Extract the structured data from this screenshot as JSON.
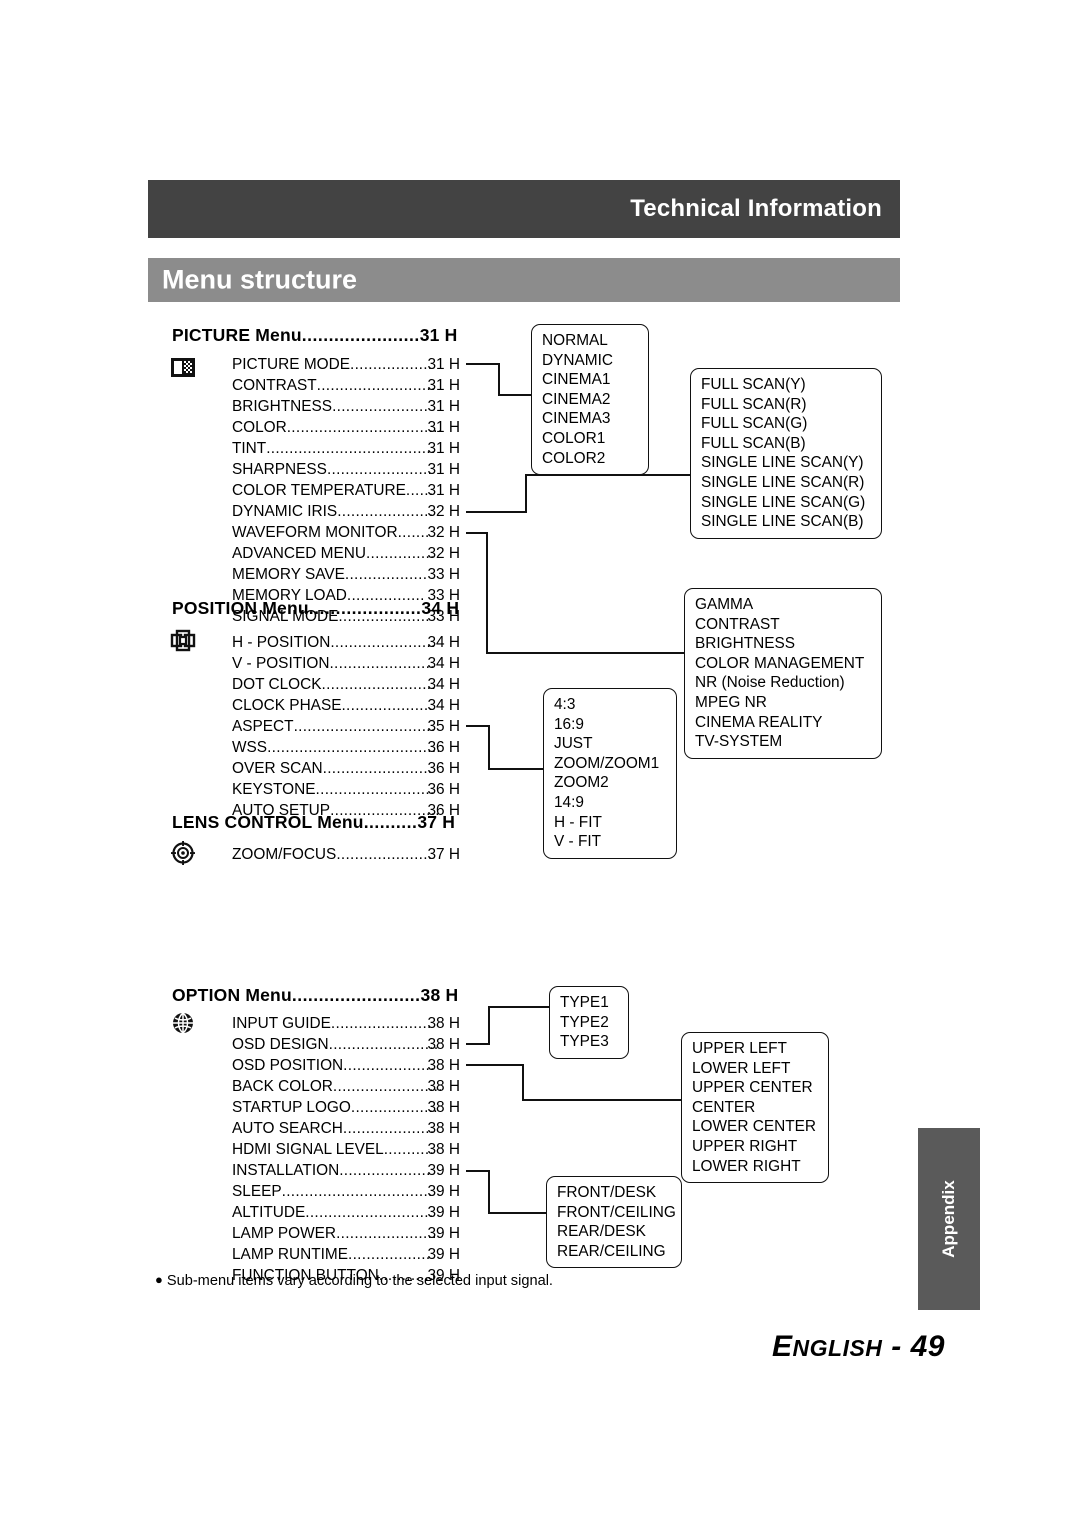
{
  "header": {
    "section_title": "Technical Information",
    "page_title": "Menu structure"
  },
  "menus": [
    {
      "id": "picture",
      "title": "PICTURE Menu",
      "dots": "......................",
      "page": "31 H",
      "icon": "picture-mode-icon",
      "items": [
        {
          "label": "PICTURE MODE",
          "dots": "..................",
          "page": "31 H"
        },
        {
          "label": "CONTRAST",
          "dots": "..........................",
          "page": "31 H"
        },
        {
          "label": "BRIGHTNESS",
          "dots": ".....................",
          "page": "31 H"
        },
        {
          "label": "COLOR",
          "dots": "..................................",
          "page": "31 H"
        },
        {
          "label": "TINT",
          "dots": ".....................................",
          "page": "31 H"
        },
        {
          "label": "SHARPNESS",
          "dots": ".......................",
          "page": "31 H"
        },
        {
          "label": "COLOR TEMPERATURE",
          "dots": "......",
          "page": "31 H"
        },
        {
          "label": "DYNAMIC IRIS",
          "dots": ".....................",
          "page": "32 H"
        },
        {
          "label": "WAVEFORM MONITOR",
          "dots": ".......",
          "page": "32 H"
        },
        {
          "label": "ADVANCED MENU",
          "dots": "...............",
          "page": "32 H"
        },
        {
          "label": "MEMORY SAVE",
          "dots": "..................",
          "page": "33 H"
        },
        {
          "label": "MEMORY LOAD",
          "dots": ".................",
          "page": "33 H"
        },
        {
          "label": "SIGNAL MODE",
          "dots": "....................",
          "page": "33 H"
        }
      ]
    },
    {
      "id": "position",
      "title": "POSITION Menu",
      "dots": ".....................",
      "page": "34 H",
      "icon": "position-icon",
      "items": [
        {
          "label": "H - POSITION",
          "dots": ".......................",
          "page": "34 H"
        },
        {
          "label": "V - POSITION",
          "dots": ".......................",
          "page": "34 H"
        },
        {
          "label": "DOT CLOCK",
          "dots": ".........................",
          "page": "34 H"
        },
        {
          "label": "CLOCK PHASE",
          "dots": "....................",
          "page": "34 H"
        },
        {
          "label": "ASPECT",
          "dots": "...............................",
          "page": "35 H"
        },
        {
          "label": "WSS",
          "dots": "......................................",
          "page": "36 H"
        },
        {
          "label": "OVER SCAN",
          "dots": "........................",
          "page": "36 H"
        },
        {
          "label": "KEYSTONE",
          "dots": "..........................",
          "page": "36 H"
        },
        {
          "label": "AUTO SETUP",
          "dots": "........................",
          "page": "36 H"
        }
      ]
    },
    {
      "id": "lens",
      "title": "LENS CONTROL Menu",
      "dots": "..........",
      "page": "37 H",
      "icon": "lens-focus-icon",
      "items": [
        {
          "label": "ZOOM/FOCUS",
          "dots": ".....................",
          "page": "37 H"
        }
      ]
    },
    {
      "id": "option",
      "title": "OPTION Menu",
      "dots": "........................",
      "page": "38 H",
      "icon": "globe-icon",
      "items": [
        {
          "label": "INPUT GUIDE",
          "dots": "......................",
          "page": "38 H"
        },
        {
          "label": "OSD DESIGN",
          "dots": "........................",
          "page": "38 H"
        },
        {
          "label": "OSD POSITION",
          "dots": "....................",
          "page": "38 H"
        },
        {
          "label": "BACK COLOR",
          "dots": "........................",
          "page": "38 H"
        },
        {
          "label": "STARTUP LOGO",
          "dots": "...................",
          "page": "38 H"
        },
        {
          "label": "AUTO SEARCH",
          "dots": "....................",
          "page": "38 H"
        },
        {
          "label": "HDMI SIGNAL LEVEL",
          "dots": "...........",
          "page": "38 H"
        },
        {
          "label": "INSTALLATION",
          "dots": "....................",
          "page": "39 H"
        },
        {
          "label": "SLEEP",
          "dots": ".................................",
          "page": "39 H"
        },
        {
          "label": "ALTITUDE",
          "dots": "............................",
          "page": "39 H"
        },
        {
          "label": "LAMP POWER",
          "dots": "......................",
          "page": "39 H"
        },
        {
          "label": "LAMP RUNTIME",
          "dots": "..................",
          "page": "39 H"
        },
        {
          "label": "FUNCTION BUTTON",
          "dots": "............",
          "page": "39 H"
        }
      ]
    }
  ],
  "callouts": {
    "picture_mode": [
      "NORMAL",
      "DYNAMIC",
      "CINEMA1",
      "CINEMA2",
      "CINEMA3",
      "COLOR1",
      "COLOR2"
    ],
    "waveform_monitor": [
      "FULL SCAN(Y)",
      "FULL SCAN(R)",
      "FULL SCAN(G)",
      "FULL SCAN(B)",
      "SINGLE LINE SCAN(Y)",
      "SINGLE LINE SCAN(R)",
      "SINGLE LINE SCAN(G)",
      "SINGLE LINE SCAN(B)"
    ],
    "advanced_menu": [
      "GAMMA",
      "CONTRAST",
      "BRIGHTNESS",
      "COLOR MANAGEMENT",
      "NR (Noise Reduction)",
      "MPEG NR",
      "CINEMA REALITY",
      "TV-SYSTEM"
    ],
    "aspect": [
      "4:3",
      "16:9",
      "JUST",
      "ZOOM/ZOOM1",
      "ZOOM2",
      "14:9",
      "H - FIT",
      "V - FIT"
    ],
    "osd_design": [
      "TYPE1",
      "TYPE2",
      "TYPE3"
    ],
    "osd_position": [
      "UPPER LEFT",
      "LOWER LEFT",
      "UPPER CENTER",
      "CENTER",
      "LOWER CENTER",
      "UPPER RIGHT",
      "LOWER RIGHT"
    ],
    "installation": [
      "FRONT/DESK",
      "FRONT/CEILING",
      "REAR/DESK",
      "REAR/CEILING"
    ]
  },
  "footer": {
    "note_bullet": "●",
    "note": "Sub-menu items vary according to the selected input signal.",
    "language_big": "E",
    "language_small": "NGLISH",
    "page_sep": " - ",
    "page_number": "49",
    "tab_label": "Appendix"
  }
}
